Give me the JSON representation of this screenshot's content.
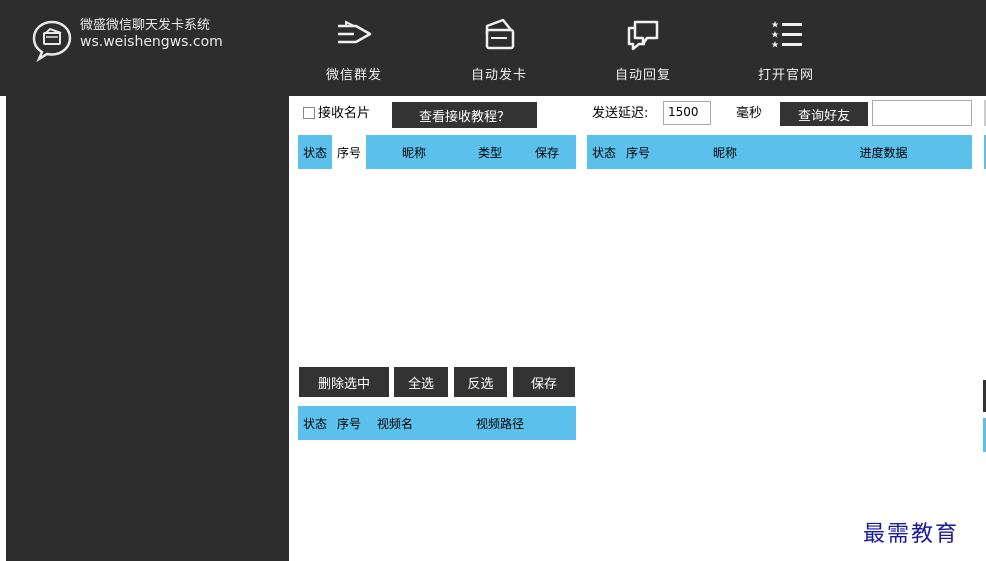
{
  "brand": {
    "name": "微盛微信聊天发卡系统",
    "site": "ws.weishengws.com"
  },
  "nav": [
    {
      "label": "微信群发",
      "icon": "send-icon"
    },
    {
      "label": "自动发卡",
      "icon": "card-icon"
    },
    {
      "label": "自动回复",
      "icon": "chat-icon"
    },
    {
      "label": "打开官网",
      "icon": "list-icon"
    }
  ],
  "toolbar": {
    "receive_card": "接收名片",
    "tutorial": "查看接收教程？",
    "delay_label": "发送延迟:",
    "delay_value": "1500",
    "delay_unit": "毫秒",
    "query_friends": "查询好友",
    "query_value": ""
  },
  "table_cards": {
    "headers": [
      "状态",
      "序号",
      "昵称",
      "类型",
      "保存"
    ]
  },
  "table_progress": {
    "headers": [
      "状态",
      "序号",
      "昵称",
      "进度数据"
    ]
  },
  "actions": {
    "delete_selected": "删除选中",
    "select_all": "全选",
    "invert": "反选",
    "save": "保存"
  },
  "table_videos": {
    "headers": [
      "状态",
      "序号",
      "视频名",
      "视频路径"
    ]
  },
  "watermark": "最需教育",
  "colors": {
    "dark_bg": "#2d2d2d",
    "header_blue": "#5bc0eb",
    "button_dark": "#333333"
  }
}
